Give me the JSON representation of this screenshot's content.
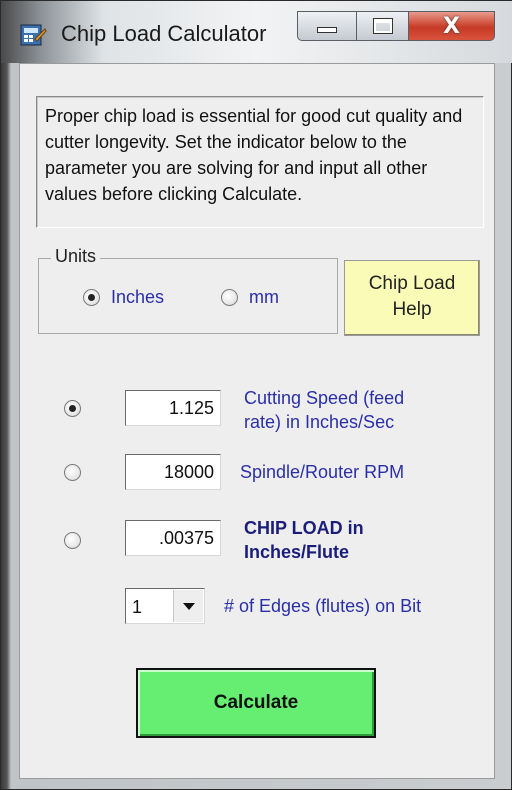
{
  "window": {
    "title": "Chip Load Calculator",
    "close_glyph": "X"
  },
  "info_text": "Proper chip load is essential for good cut quality and cutter longevity. Set the indicator below to the parameter you are solving for and input all other values before clicking Calculate.",
  "units": {
    "legend": "Units",
    "options": [
      {
        "label": "Inches",
        "selected": true
      },
      {
        "label": "mm",
        "selected": false
      }
    ]
  },
  "help_button": {
    "line1": "Chip Load",
    "line2": "Help"
  },
  "parameters": [
    {
      "value": "1.125",
      "label_line1": "Cutting Speed (feed",
      "label_line2": "rate) in Inches/Sec",
      "selected": true
    },
    {
      "value": "18000",
      "label_line1": "Spindle/Router RPM",
      "label_line2": "",
      "selected": false
    },
    {
      "value": ".00375",
      "label_line1": "CHIP LOAD in",
      "label_line2": "Inches/Flute",
      "selected": false
    }
  ],
  "edges": {
    "value": "1",
    "label": "# of Edges (flutes) on Bit"
  },
  "calculate_label": "Calculate",
  "colors": {
    "accent_text": "#2a2fa8",
    "help_button_bg": "#fbfbb8",
    "calculate_bg": "#66ee73",
    "close_button": "#c73a25"
  }
}
